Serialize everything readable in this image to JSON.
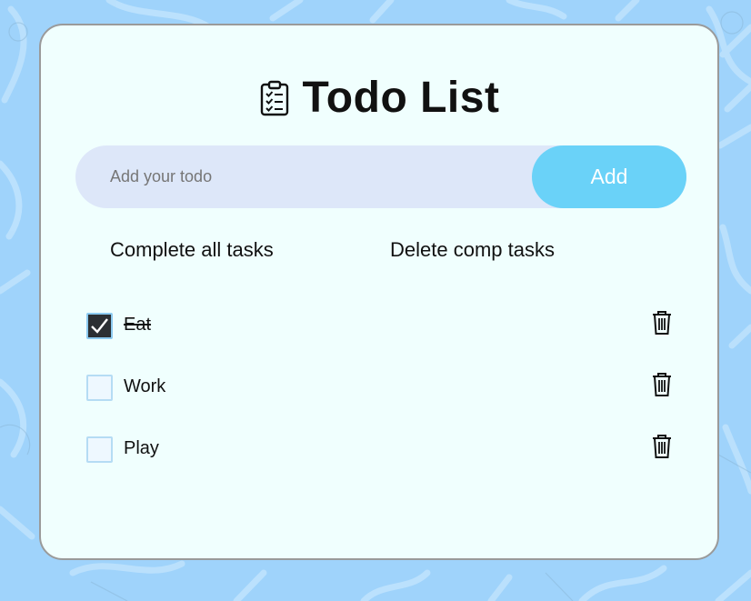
{
  "app": {
    "title": "Todo List",
    "title_icon": "clipboard-checklist-icon"
  },
  "input": {
    "placeholder": "Add your todo",
    "value": ""
  },
  "add_button": {
    "label": "Add"
  },
  "actions": {
    "complete_all_label": "Complete all tasks",
    "delete_completed_label": "Delete comp tasks"
  },
  "todos": [
    {
      "label": "Eat",
      "completed": true
    },
    {
      "label": "Work",
      "completed": false
    },
    {
      "label": "Play",
      "completed": false
    }
  ],
  "colors": {
    "background": "#9fd3fb",
    "card": "#f0fffe",
    "input_bg": "#dde7f9",
    "add_button": "#6ad2f8",
    "checked_box": "#2b2f33"
  },
  "icons": {
    "checkbox_check": "check-icon",
    "delete": "trash-icon"
  }
}
